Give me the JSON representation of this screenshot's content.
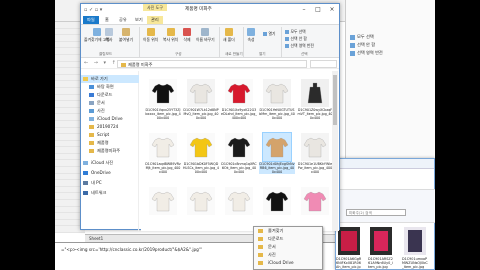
{
  "explorer": {
    "title": "제품명 미화주",
    "manage_tab_top": "사진 도구",
    "tabs": {
      "file": "파일",
      "home": "홈",
      "share": "공유",
      "view": "보기",
      "manage": "관리"
    },
    "ribbon": {
      "pin": "즐겨찾기에 고정",
      "copy": "복사",
      "paste": "붙여넣기",
      "move": "이동 위치",
      "copy_to": "복사 위치",
      "delete": "삭제",
      "rename": "이름 바꾸기",
      "new_folder": "새 폴더",
      "properties": "속성",
      "open": "열기",
      "select_all": "모두 선택",
      "select_none": "선택 안 함",
      "invert": "선택 영역 반전",
      "group_clipboard": "클립보드",
      "group_organize": "구성",
      "group_new": "새로 만들기",
      "group_open": "열기",
      "group_select": "선택"
    },
    "address": "제품명 미화주",
    "nav": [
      {
        "label": "바로 가기",
        "selected": true
      },
      {
        "label": "바탕 화면",
        "selected": false
      },
      {
        "label": "다운로드",
        "selected": false
      },
      {
        "label": "문서",
        "selected": false
      },
      {
        "label": "사진",
        "selected": false
      },
      {
        "label": "iCloud Drive",
        "selected": false
      },
      {
        "label": "20190724",
        "selected": false
      },
      {
        "label": "Script",
        "selected": false
      },
      {
        "label": "제품명",
        "selected": false
      },
      {
        "label": "제품명미화주",
        "selected": false
      },
      {
        "label": "iCloud 사진",
        "selected": false
      },
      {
        "label": "OneDrive",
        "selected": false
      },
      {
        "label": "내 PC",
        "selected": false
      },
      {
        "label": "네트워크",
        "selected": false
      }
    ],
    "files": [
      {
        "name": "D1C901Vqxx25YT3ZJbxxxx_item_pic.jpg_400x400",
        "shirt": "black-tee",
        "selected": false
      },
      {
        "name": "D1C901W7Lk12d8NPMvQ_item_pic.jpg_400x400",
        "shirt": "white-shirt",
        "selected": false
      },
      {
        "name": "D1C901Xx9yxK22G3eDLxhd_item_pic.jpg_400x400",
        "shirt": "red-tee",
        "selected": false
      },
      {
        "name": "D1C901YeNXGTUTUSbMm_item_pic.jpg_400x400",
        "shirt": "white-shirt",
        "selected": false
      },
      {
        "name": "D1C901Z0wyXCbzqFmVT_item_pic.jpg_400x400",
        "shirt": "model",
        "selected": false
      },
      {
        "name": "D1C901aqdBWB9VRzMJt_item_pic.jpg_400x400",
        "shirt": "white-tee",
        "selected": false
      },
      {
        "name": "D1C901bDK0F5WQDHLSCs_item_pic.jpg_400x400",
        "shirt": "yellow-sweater",
        "selected": false
      },
      {
        "name": "D1C901c8nmq1qXRC6Ok_item_pic.jpg_400x400",
        "shirt": "black-sweater",
        "selected": false
      },
      {
        "name": "D1C901d0hjExgShNvRB6_item_pic.jpg_400x400",
        "shirt": "tan-cardigan",
        "selected": true
      },
      {
        "name": "D1C901e1UBKkYWlePw_item_pic.jpg_400x400",
        "shirt": "white-shirt",
        "selected": false
      },
      {
        "name": "",
        "shirt": "white-tee",
        "selected": false
      },
      {
        "name": "",
        "shirt": "white-tee",
        "selected": false
      },
      {
        "name": "",
        "shirt": "white-tee",
        "selected": false
      },
      {
        "name": "",
        "shirt": "black-tee",
        "selected": false
      },
      {
        "name": "",
        "shirt": "pink-sweater",
        "selected": false
      }
    ]
  },
  "context_menu": [
    "즐겨찾기",
    "다운로드",
    "문서",
    "사진",
    "iCloud Drive"
  ],
  "window2": {
    "search": "미화주(2) 검색",
    "files": [
      {
        "name": "D1C901A6GgR6NiFKx081R06Ah_item_pic.jpg"
      },
      {
        "name": "D1C901ARSZ261A9Nn6Uy0_item_pic.jpg"
      },
      {
        "name": "D1C901umxoPMWZUNsOJ0bC_item_pic.jpg"
      }
    ],
    "ribbon": [
      "모두 선택",
      "선택 안 함",
      "선택 영역 반전"
    ]
  },
  "sheet": {
    "formula": "=\"<p><img src='http://cnclassic.co.kr/2019product/\"&$A2&\".jpg'\"",
    "tabs": "Sheet1"
  },
  "colors": {
    "file_tab": "#1979ca",
    "selection": "#cce8ff",
    "manage": "#f7e79a",
    "folder": "#e5b84a"
  }
}
